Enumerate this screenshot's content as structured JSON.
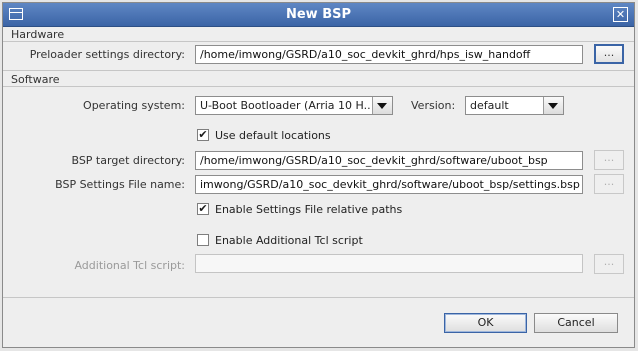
{
  "window": {
    "title": "New BSP",
    "close_glyph": "✕"
  },
  "hardware": {
    "legend": "Hardware",
    "preloader_label": "Preloader settings directory:",
    "preloader_value": "/home/imwong/GSRD/a10_soc_devkit_ghrd/hps_isw_handoff",
    "browse": "..."
  },
  "software": {
    "legend": "Software",
    "os_label": "Operating system:",
    "os_value": "U-Boot Bootloader (Arria 10 H...",
    "version_label": "Version:",
    "version_value": "default",
    "use_default_label": "Use default locations",
    "use_default_checked": true,
    "target_dir_label": "BSP target directory:",
    "target_dir_value": "/home/imwong/GSRD/a10_soc_devkit_ghrd/software/uboot_bsp",
    "settings_file_label": "BSP Settings File name:",
    "settings_file_value": "imwong/GSRD/a10_soc_devkit_ghrd/software/uboot_bsp/settings.bsp",
    "relative_paths_label": "Enable Settings File relative paths",
    "relative_paths_checked": true,
    "tcl_enable_label": "Enable Additional Tcl script",
    "tcl_enable_checked": false,
    "tcl_script_label": "Additional Tcl script:",
    "tcl_script_value": "",
    "browse": "..."
  },
  "buttons": {
    "ok": "OK",
    "cancel": "Cancel"
  },
  "check_glyph": "✔"
}
